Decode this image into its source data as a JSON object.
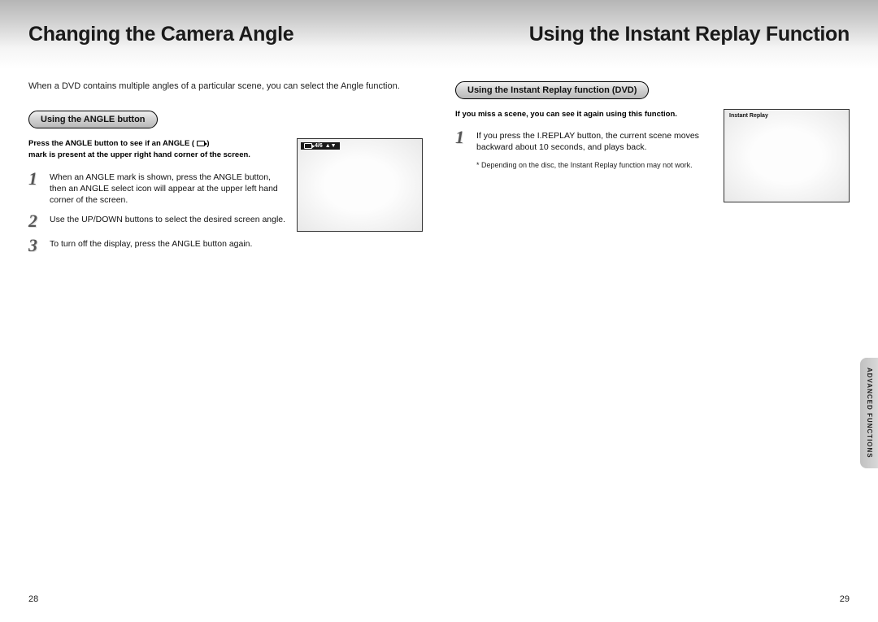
{
  "header": {
    "left_title": "Changing the Camera Angle",
    "right_title": "Using the Instant Replay Function"
  },
  "left": {
    "intro": "When a DVD contains multiple angles of a particular scene, you can select the Angle function.",
    "pill": "Using the ANGLE button",
    "bold_intro_1": "Press the ANGLE button to see if an ANGLE (",
    "bold_intro_2": ")",
    "bold_intro_3": "mark is present at the upper right hand corner of the screen.",
    "steps": [
      {
        "n": "1",
        "text": "When an ANGLE mark is shown, press the ANGLE button, then an ANGLE select icon will appear at the upper left hand corner of the screen."
      },
      {
        "n": "2",
        "text": "Use the UP/DOWN buttons to select the desired screen angle."
      },
      {
        "n": "3",
        "text": "To turn off the display, press the ANGLE button again."
      }
    ],
    "screen_label": "4/6"
  },
  "right": {
    "pill": "Using the Instant Replay function (DVD)",
    "bold_intro": "If you miss a scene, you can see it again using this function.",
    "steps": [
      {
        "n": "1",
        "text": "If you press the I.REPLAY button, the current scene moves backward about 10 seconds, and plays back."
      }
    ],
    "note": "* Depending on the disc, the Instant Replay function may not work.",
    "screen_label": "Instant Replay"
  },
  "side_tab": "ADVANCED FUNCTIONS",
  "footer": {
    "left_page": "28",
    "right_page": "29"
  }
}
